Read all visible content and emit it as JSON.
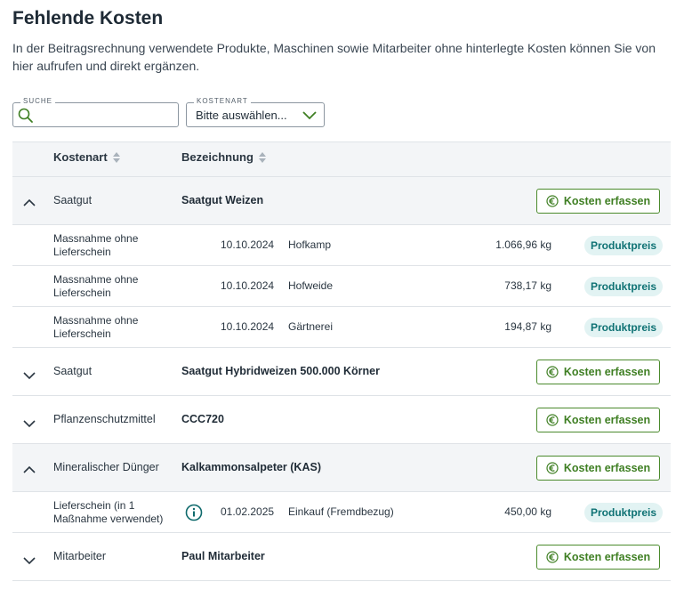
{
  "page": {
    "title": "Fehlende Kosten",
    "description": "In der Beitragsrechnung verwendete Produkte, Maschinen sowie Mitarbeiter ohne hinterlegte Kosten können Sie von hier aufrufen und direkt ergänzen."
  },
  "filters": {
    "search_label": "SUCHE",
    "search_value": "",
    "kostenart_label": "KOSTENART",
    "kostenart_value": "Bitte auswählen..."
  },
  "table": {
    "col_kostenart": "Kostenart",
    "col_bezeichnung": "Bezeichnung",
    "button_label": "Kosten erfassen",
    "groups": [
      {
        "kind": "Saatgut",
        "name": "Saatgut Weizen",
        "expanded": true,
        "details": [
          {
            "kind": "Massnahme ohne Lieferschein",
            "date": "10.10.2024",
            "place": "Hofkamp",
            "qty": "1.066,96 kg",
            "badge": "Produktpreis"
          },
          {
            "kind": "Massnahme ohne Lieferschein",
            "date": "10.10.2024",
            "place": "Hofweide",
            "qty": "738,17 kg",
            "badge": "Produktpreis"
          },
          {
            "kind": "Massnahme ohne Lieferschein",
            "date": "10.10.2024",
            "place": "Gärtnerei",
            "qty": "194,87 kg",
            "badge": "Produktpreis"
          }
        ]
      },
      {
        "kind": "Saatgut",
        "name": "Saatgut Hybridweizen 500.000 Körner",
        "expanded": false
      },
      {
        "kind": "Pflanzenschutzmittel",
        "name": "CCC720",
        "expanded": false
      },
      {
        "kind": "Mineralischer Dünger",
        "name": "Kalkammonsalpeter (KAS)",
        "expanded": true,
        "details": [
          {
            "kind": "Lieferschein (in 1 Maßnahme verwendet)",
            "date": "01.02.2025",
            "place": "Einkauf (Fremdbezug)",
            "qty": "450,00 kg",
            "badge": "Produktpreis",
            "info": true
          }
        ]
      },
      {
        "kind": "Mitarbeiter",
        "name": "Paul Mitarbeiter",
        "expanded": false
      }
    ]
  },
  "colors": {
    "accent_green": "#3f7f23",
    "badge_bg": "#e2f3f3",
    "badge_text": "#0f7274",
    "header_bg": "#f3f5f7"
  },
  "icons": {
    "search": "search-icon",
    "dropdown": "chevron-down-icon",
    "expanded": "chevron-up-icon",
    "collapsed": "chevron-down-icon",
    "sort": "sort-icon",
    "euro": "euro-icon",
    "info": "info-icon"
  }
}
